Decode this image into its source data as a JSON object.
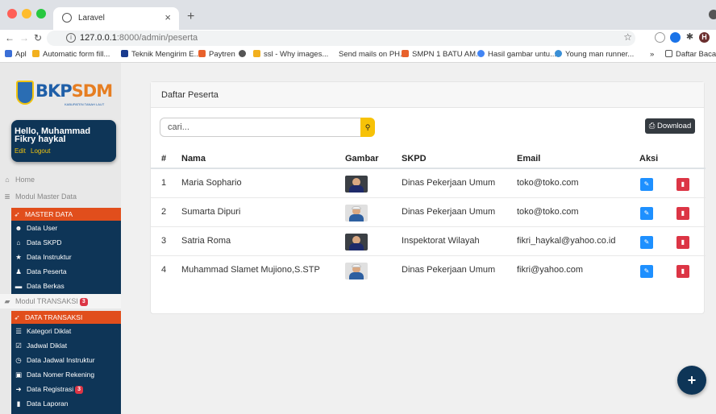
{
  "browser": {
    "tab_title": "Laravel",
    "url_host": "127.0.0.1",
    "url_rest": ":8000/admin/peserta",
    "ext_avatar_letter": "H",
    "bookmarks": [
      "Apl",
      "Automatic form fill...",
      "Teknik Mengirim E...",
      "Paytren",
      "ssl - Why images...",
      "Send mails on PH...",
      "SMPN 1 BATU AM...",
      "Hasil gambar untu...",
      "Young man runner...",
      "»",
      "Daftar Bacaan"
    ]
  },
  "sidebar": {
    "logo_text_a": "BKP",
    "logo_text_b": "SDM",
    "logo_sub": "KABUPATEN TANAH LAUT",
    "user_name": "Hello, Muhammad Fikry haykal",
    "edit_link": "Edit",
    "logout_link": "Logout",
    "home": "Home",
    "module_master": "Modul Master Data",
    "master_header": "MASTER DATA",
    "master_items": [
      "Data User",
      "Data SKPD",
      "Data Instruktur",
      "Data Peserta",
      "Data Berkas"
    ],
    "module_transaksi": "Modul TRANSAKSI",
    "module_transaksi_badge": "3",
    "transaksi_header": "DATA TRANSAKSI",
    "transaksi_items": [
      "Kategori Diklat",
      "Jadwal Diklat",
      "Data Jadwal Instruktur",
      "Data Nomer Rekening",
      "Data Registrasi",
      "Data Laporan"
    ],
    "registrasi_badge": "3"
  },
  "card": {
    "title": "Daftar Peserta",
    "search_placeholder": "cari...",
    "download_label": "Download"
  },
  "table": {
    "headers": [
      "#",
      "Nama",
      "Gambar",
      "SKPD",
      "Email",
      "Aksi"
    ],
    "rows": [
      {
        "no": "1",
        "nama": "Maria Sophario",
        "skpd": "Dinas Pekerjaan Umum",
        "email": "toko@toko.com"
      },
      {
        "no": "2",
        "nama": "Sumarta Dipuri",
        "skpd": "Dinas Pekerjaan Umum",
        "email": "toko@toko.com"
      },
      {
        "no": "3",
        "nama": "Satria Roma",
        "skpd": "Inspektorat Wilayah",
        "email": "fikri_haykal@yahoo.co.id"
      },
      {
        "no": "4",
        "nama": "Muhammad Slamet Mujiono,S.STP",
        "skpd": "Dinas Pekerjaan Umum",
        "email": "fikri@yahoo.com"
      }
    ]
  },
  "fab_label": "+"
}
